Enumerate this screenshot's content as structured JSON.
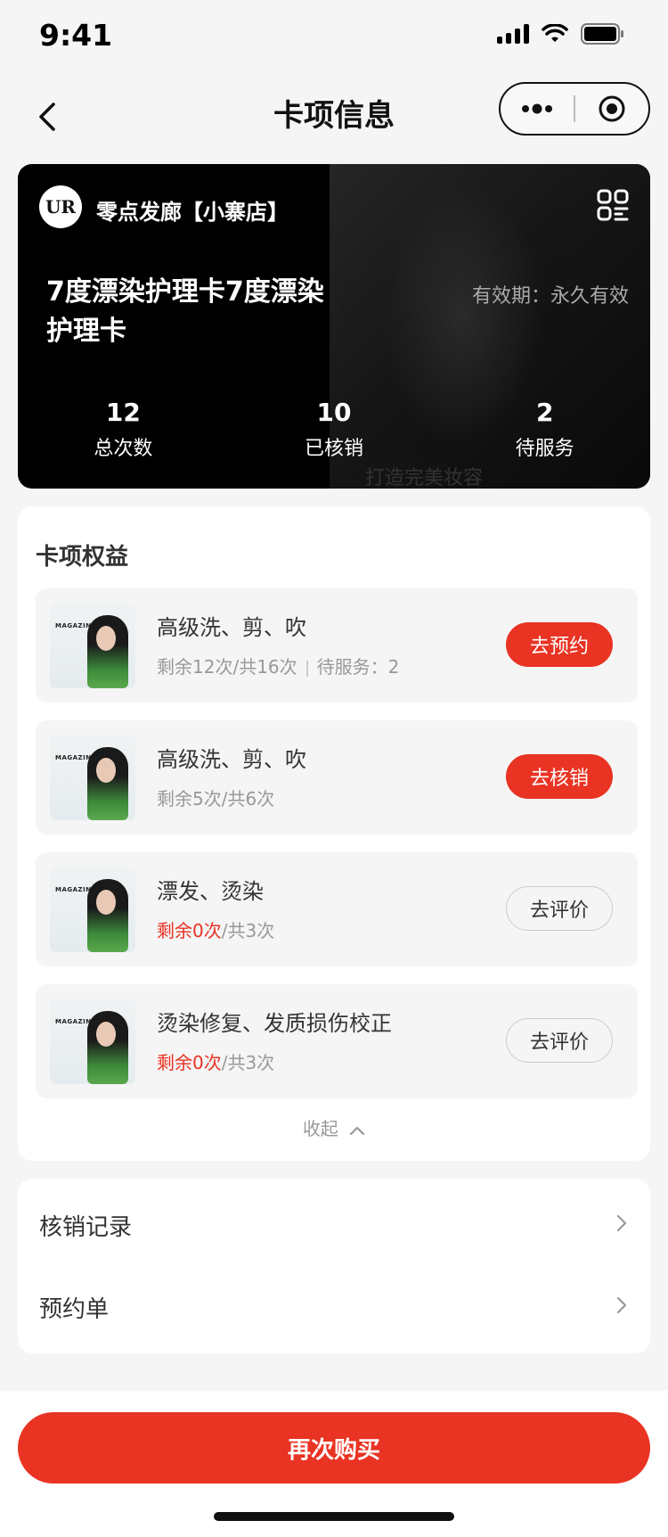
{
  "status_bar": {
    "time": "9:41"
  },
  "nav": {
    "title": "卡项信息"
  },
  "card": {
    "logo_text": "UR",
    "store_name": "零点发廊【小寨店】",
    "title": "7度漂染护理卡7度漂染护理卡",
    "validity": "有效期：永久有效",
    "watermark": "打造完美妆容",
    "stats": [
      {
        "value": "12",
        "label": "总次数"
      },
      {
        "value": "10",
        "label": "已核销"
      },
      {
        "value": "2",
        "label": "待服务"
      }
    ]
  },
  "benefits": {
    "title": "卡项权益",
    "thumb_text": "MAGAZINE",
    "items": [
      {
        "name": "高级洗、剪、吹",
        "remain": "剩余12次",
        "total": "/共16次",
        "pending": "待服务：2",
        "button": "去预约",
        "button_style": "primary",
        "remain_red": false
      },
      {
        "name": "高级洗、剪、吹",
        "remain": "剩余5次",
        "total": "/共6次",
        "pending": "",
        "button": "去核销",
        "button_style": "primary",
        "remain_red": false
      },
      {
        "name": "漂发、烫染",
        "remain": "剩余0次",
        "total": "/共3次",
        "pending": "",
        "button": "去评价",
        "button_style": "outline",
        "remain_red": true
      },
      {
        "name": "烫染修复、发质损伤校正",
        "remain": "剩余0次",
        "total": "/共3次",
        "pending": "",
        "button": "去评价",
        "button_style": "outline",
        "remain_red": true
      }
    ],
    "collapse_label": "收起"
  },
  "links": [
    {
      "label": "核销记录"
    },
    {
      "label": "预约单"
    }
  ],
  "bottom": {
    "buy_label": "再次购买"
  },
  "colors": {
    "accent": "#e93323",
    "background": "#f5f5f5"
  }
}
